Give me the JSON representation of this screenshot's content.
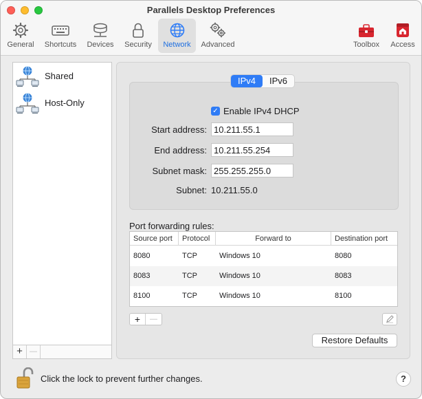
{
  "window": {
    "title": "Parallels Desktop Preferences",
    "colors": {
      "close": "#ff5f57",
      "minimize": "#febc2e",
      "maximize": "#28c840",
      "accent": "#2f7cf6"
    }
  },
  "toolbar": {
    "items": [
      {
        "label": "General",
        "icon": "gear-icon"
      },
      {
        "label": "Shortcuts",
        "icon": "keyboard-icon"
      },
      {
        "label": "Devices",
        "icon": "devices-icon"
      },
      {
        "label": "Security",
        "icon": "lock-icon"
      },
      {
        "label": "Network",
        "icon": "globe-icon",
        "active": true
      },
      {
        "label": "Advanced",
        "icon": "gears-icon"
      },
      {
        "label": "Toolbox",
        "icon": "toolbox-icon"
      },
      {
        "label": "Access",
        "icon": "access-icon"
      }
    ]
  },
  "sidebar": {
    "items": [
      {
        "label": "Shared",
        "icon": "network-icon"
      },
      {
        "label": "Host-Only",
        "icon": "network-icon"
      }
    ],
    "add_label": "+",
    "remove_label": "—"
  },
  "main": {
    "tabs": [
      {
        "label": "IPv4",
        "selected": true
      },
      {
        "label": "IPv6",
        "selected": false
      }
    ],
    "dhcp": {
      "label": "Enable IPv4 DHCP",
      "checked": true
    },
    "fields": {
      "start_label": "Start address:",
      "start_value": "10.211.55.1",
      "end_label": "End address:",
      "end_value": "10.211.55.254",
      "mask_label": "Subnet mask:",
      "mask_value": "255.255.255.0",
      "subnet_label": "Subnet:",
      "subnet_value": "10.211.55.0"
    },
    "port_forwarding": {
      "title": "Port forwarding rules:",
      "columns": [
        "Source port",
        "Protocol",
        "Forward to",
        "Destination port"
      ],
      "rows": [
        [
          "8080",
          "TCP",
          "Windows 10",
          "8080"
        ],
        [
          "8083",
          "TCP",
          "Windows 10",
          "8083"
        ],
        [
          "8100",
          "TCP",
          "Windows 10",
          "8100"
        ]
      ],
      "add_label": "+",
      "remove_label": "—"
    },
    "restore_label": "Restore Defaults"
  },
  "footer": {
    "lock_text": "Click the lock to prevent further changes.",
    "help_label": "?"
  }
}
